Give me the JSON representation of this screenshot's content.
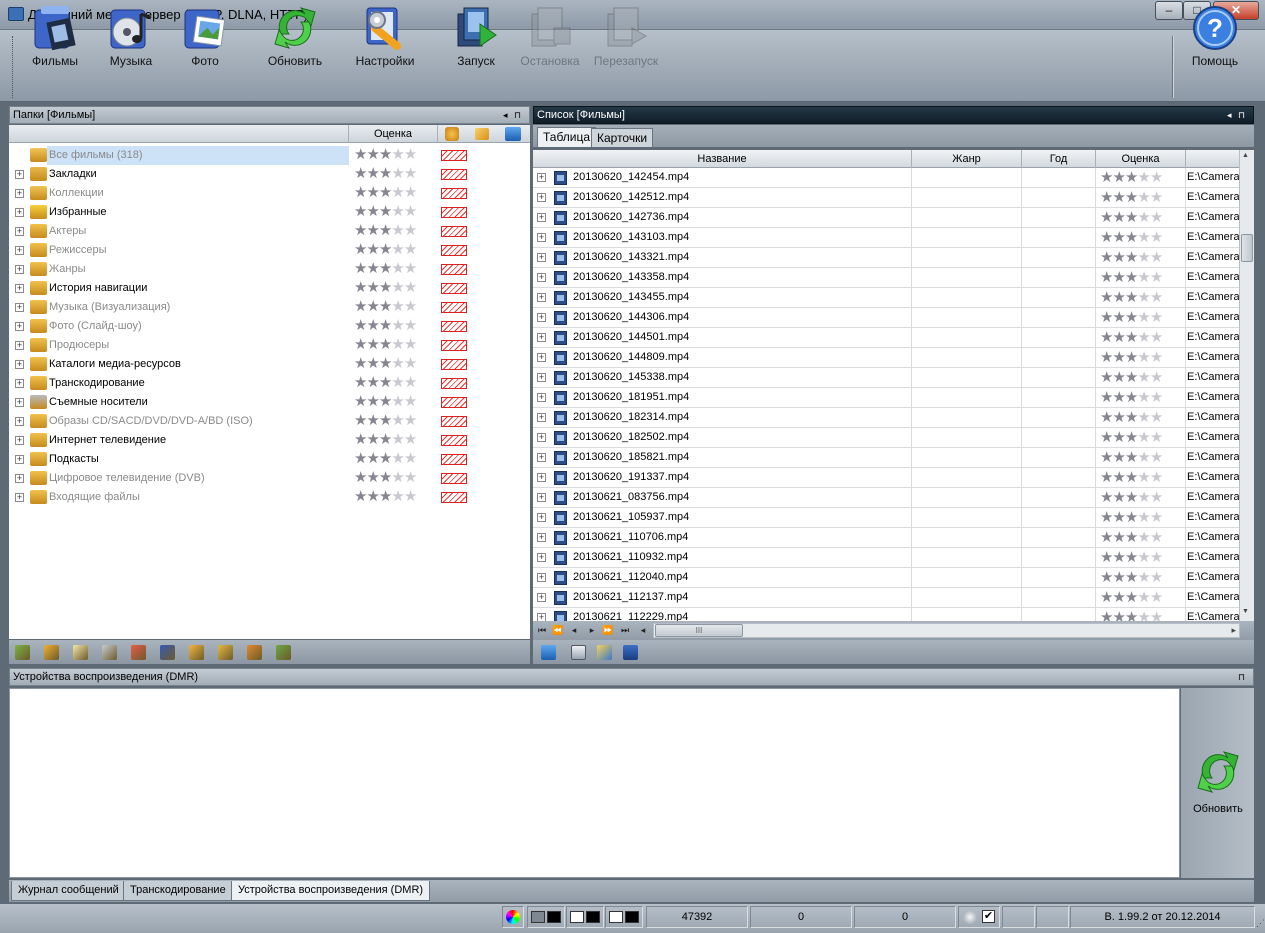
{
  "window": {
    "title": "Домашний медиа-сервер (UPnP, DLNA, HTTP)",
    "min": "–",
    "max": "□",
    "close": "✕"
  },
  "toolbar": {
    "films": "Фильмы",
    "music": "Музыка",
    "photo": "Фото",
    "refresh": "Обновить",
    "settings": "Настройки",
    "start": "Запуск",
    "stop": "Остановка",
    "restart": "Перезапуск",
    "help": "Помощь"
  },
  "left_panel": {
    "title": "Папки [Фильмы]",
    "pin": "◂ ⊓",
    "rating_col": "Оценка",
    "items": [
      {
        "label": "Все фильмы (318)",
        "grey": true,
        "selected": true
      },
      {
        "label": "Закладки",
        "grey": false
      },
      {
        "label": "Коллекции",
        "grey": true
      },
      {
        "label": "Избранные",
        "grey": false
      },
      {
        "label": "Актеры",
        "grey": true
      },
      {
        "label": "Режиссеры",
        "grey": true
      },
      {
        "label": "Жанры",
        "grey": true
      },
      {
        "label": "История навигации",
        "grey": false
      },
      {
        "label": "Музыка (Визуализация)",
        "grey": true
      },
      {
        "label": "Фото (Слайд-шоу)",
        "grey": true
      },
      {
        "label": "Продюсеры",
        "grey": true
      },
      {
        "label": "Каталоги медиа-ресурсов",
        "grey": false
      },
      {
        "label": "Транскодирование",
        "grey": false
      },
      {
        "label": "Съемные носители",
        "grey": false
      },
      {
        "label": "Образы CD/SACD/DVD/DVD-A/BD (ISO)",
        "grey": true
      },
      {
        "label": "Интернет телевидение",
        "grey": false
      },
      {
        "label": "Подкасты",
        "grey": false
      },
      {
        "label": "Цифровое телевидение (DVB)",
        "grey": true
      },
      {
        "label": "Входящие файлы",
        "grey": true
      }
    ],
    "rating_stars": 3
  },
  "right_panel": {
    "title": "Список [Фильмы]",
    "pin": "◂ ⊓",
    "tabs": [
      "Таблица",
      "Карточки"
    ],
    "columns": [
      "Название",
      "Жанр",
      "Год",
      "Оценка"
    ],
    "path_prefix": "E:\\Camera",
    "files": [
      "20130620_142454.mp4",
      "20130620_142512.mp4",
      "20130620_142736.mp4",
      "20130620_143103.mp4",
      "20130620_143321.mp4",
      "20130620_143358.mp4",
      "20130620_143455.mp4",
      "20130620_144306.mp4",
      "20130620_144501.mp4",
      "20130620_144809.mp4",
      "20130620_145338.mp4",
      "20130620_181951.mp4",
      "20130620_182314.mp4",
      "20130620_182502.mp4",
      "20130620_185821.mp4",
      "20130620_191337.mp4",
      "20130621_083756.mp4",
      "20130621_105937.mp4",
      "20130621_110706.mp4",
      "20130621_110932.mp4",
      "20130621_112040.mp4",
      "20130621_112137.mp4",
      "20130621_112229.mp4"
    ],
    "scroll_thumb_grip": "III"
  },
  "dmr": {
    "title": "Устройства воспроизведения (DMR)",
    "pin": "⊓",
    "refresh": "Обновить"
  },
  "bottom_tabs": [
    "Журнал сообщений",
    "Транскодирование",
    "Устройства воспроизведения (DMR)"
  ],
  "status": {
    "count1": "47392",
    "count2": "0",
    "count3": "0",
    "version": "В. 1.99.2 от 20.12.2014"
  }
}
